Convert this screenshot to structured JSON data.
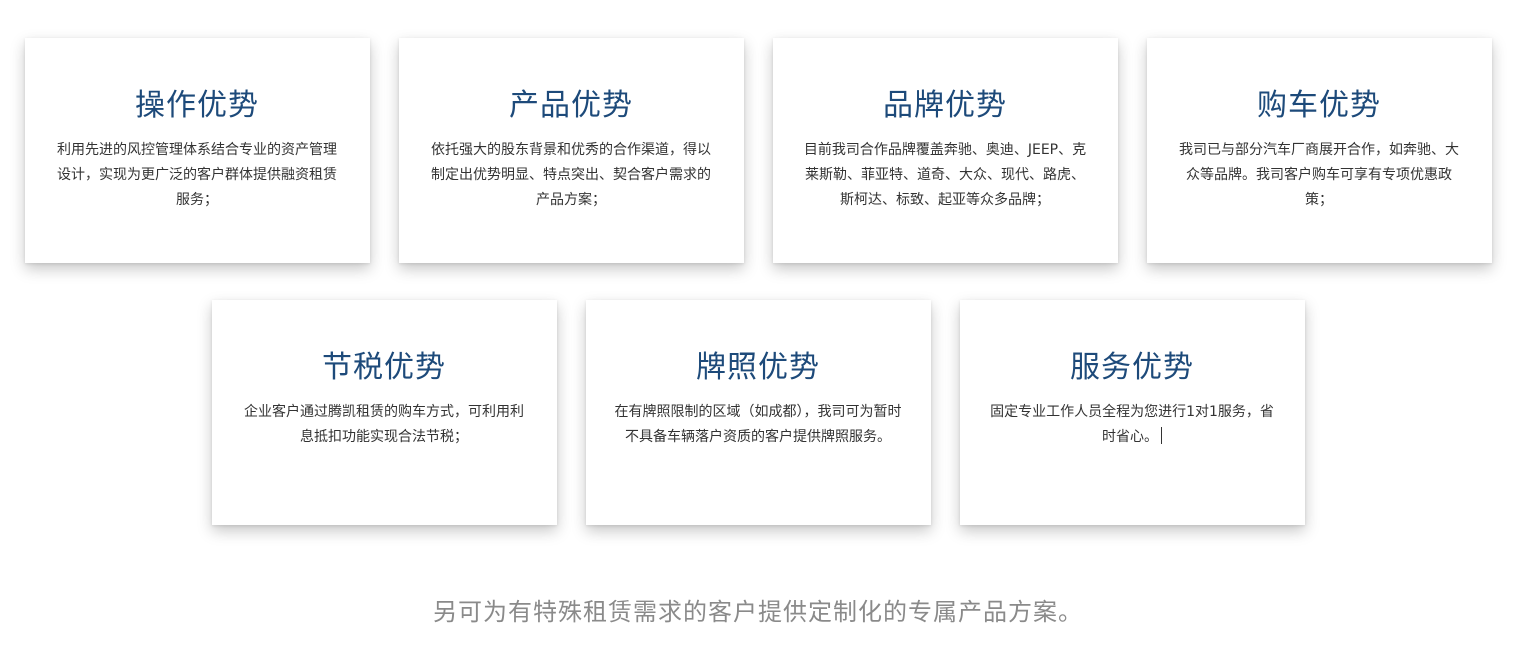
{
  "cards_row1": [
    {
      "title": "操作优势",
      "text": "利用先进的风控管理体系结合专业的资产管理设计，实现为更广泛的客户群体提供融资租赁服务；"
    },
    {
      "title": "产品优势",
      "text": "依托强大的股东背景和优秀的合作渠道，得以制定出优势明显、特点突出、契合客户需求的产品方案；"
    },
    {
      "title": "品牌优势",
      "text": "目前我司合作品牌覆盖奔驰、奥迪、JEEP、克莱斯勒、菲亚特、道奇、大众、现代、路虎、斯柯达、标致、起亚等众多品牌；"
    },
    {
      "title": "购车优势",
      "text": "我司已与部分汽车厂商展开合作，如奔驰、大众等品牌。我司客户购车可享有专项优惠政策；"
    }
  ],
  "cards_row2": [
    {
      "title": "节税优势",
      "text": "企业客户通过腾凯租赁的购车方式，可利用利息抵扣功能实现合法节税；"
    },
    {
      "title": "牌照优势",
      "text": "在有牌照限制的区域（如成都），我司可为暂时不具备车辆落户资质的客户提供牌照服务。"
    },
    {
      "title": "服务优势",
      "text": "固定专业工作人员全程为您进行1对1服务，省时省心。"
    }
  ],
  "footer": {
    "note": "另可为有特殊租赁需求的客户提供定制化的专属产品方案。"
  }
}
